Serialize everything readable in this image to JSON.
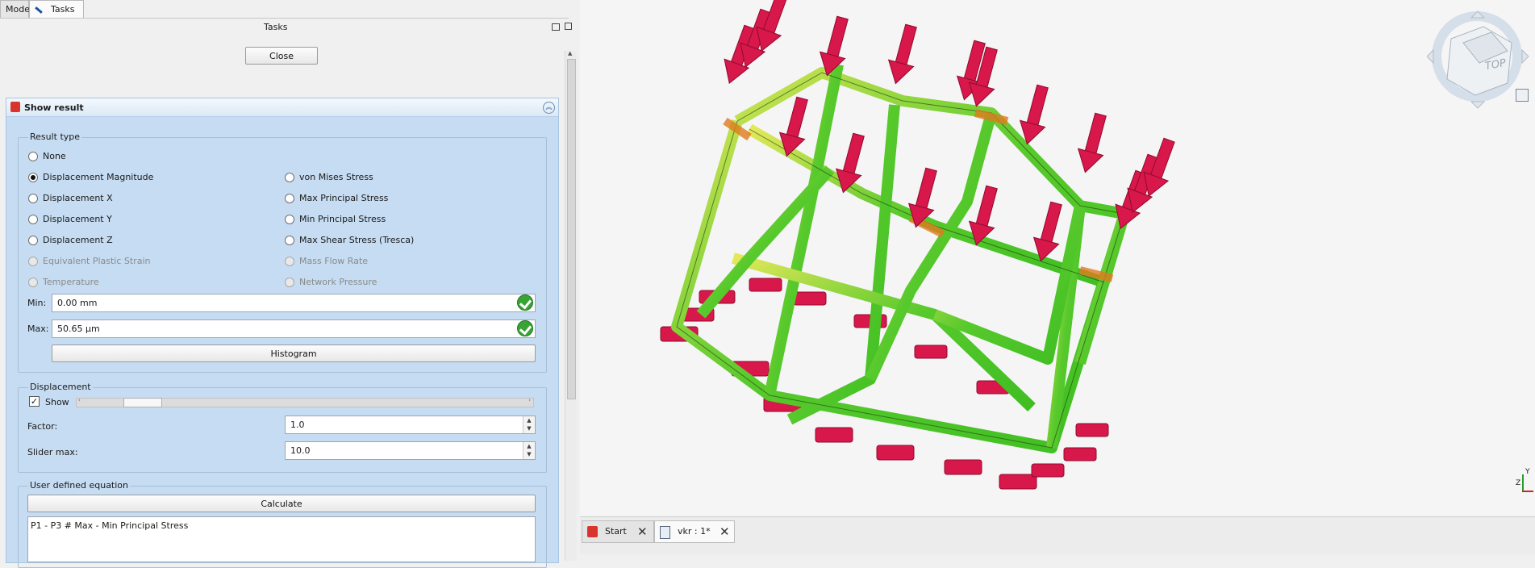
{
  "top_tabs": [
    {
      "label": "Model",
      "active": false
    },
    {
      "label": "Tasks",
      "active": true
    }
  ],
  "panel": {
    "title": "Tasks",
    "close_label": "Close"
  },
  "show_result": {
    "title": "Show result",
    "result_type": {
      "title": "Result type",
      "options_left": [
        {
          "label": "None",
          "checked": false,
          "enabled": true
        },
        {
          "label": "Displacement Magnitude",
          "checked": true,
          "enabled": true
        },
        {
          "label": "Displacement X",
          "checked": false,
          "enabled": true
        },
        {
          "label": "Displacement Y",
          "checked": false,
          "enabled": true
        },
        {
          "label": "Displacement Z",
          "checked": false,
          "enabled": true
        },
        {
          "label": "Equivalent Plastic Strain",
          "checked": false,
          "enabled": false
        },
        {
          "label": "Temperature",
          "checked": false,
          "enabled": false
        }
      ],
      "options_right": [
        {
          "label": "von Mises Stress",
          "checked": false,
          "enabled": true
        },
        {
          "label": "Max Principal Stress",
          "checked": false,
          "enabled": true
        },
        {
          "label": "Min Principal Stress",
          "checked": false,
          "enabled": true
        },
        {
          "label": "Max Shear Stress (Tresca)",
          "checked": false,
          "enabled": true
        },
        {
          "label": "Mass Flow Rate",
          "checked": false,
          "enabled": false
        },
        {
          "label": "Network Pressure",
          "checked": false,
          "enabled": false
        }
      ],
      "min_label": "Min:",
      "min_value": "0.00 mm",
      "max_label": "Max:",
      "max_value": "50.65 µm",
      "histogram_label": "Histogram"
    },
    "displacement": {
      "title": "Displacement",
      "show_label": "Show",
      "show_checked": true,
      "factor_label": "Factor:",
      "factor_value": "1.0",
      "slider_max_label": "Slider max:",
      "slider_max_value": "10.0"
    },
    "equation": {
      "title": "User defined equation",
      "calculate_label": "Calculate",
      "text": "P1 - P3 # Max - Min Principal Stress"
    }
  },
  "nav_cube": {
    "face_label": "TOP"
  },
  "axes": {
    "y": "Y",
    "z": "Z"
  },
  "doc_tabs": [
    {
      "label": "Start",
      "active": false
    },
    {
      "label": "vkr : 1*",
      "active": true
    }
  ]
}
